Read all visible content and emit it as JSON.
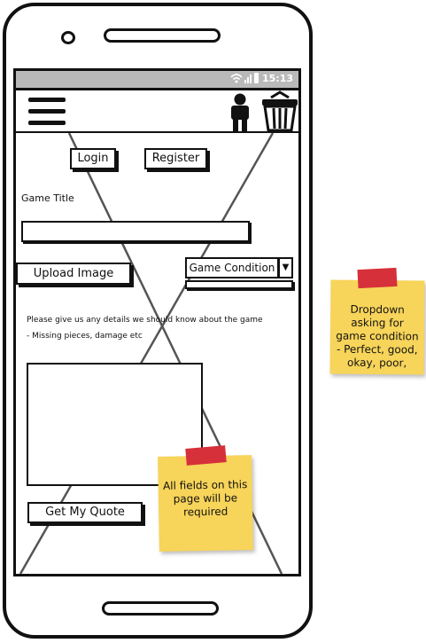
{
  "status_bar": {
    "time": "15:13",
    "icons": [
      "wifi-icon",
      "signal-icon",
      "battery-icon"
    ]
  },
  "header": {
    "menu_icon": "hamburger-icon",
    "profile_icon": "person-icon",
    "cart_icon": "basket-icon"
  },
  "auth": {
    "login_label": "Login",
    "register_label": "Register"
  },
  "form": {
    "game_title_label": "Game Title",
    "game_title_value": "",
    "upload_label": "Upload Image",
    "condition_label": "Game Condition",
    "details_prompt": "Please give us any details we should know about the game",
    "details_hint": "- Missing pieces, damage etc",
    "details_value": "",
    "quote_button": "Get My Quote"
  },
  "notes": {
    "required_note": "All fields on this page will be required",
    "dropdown_note": "Dropdown asking for game condition - Perfect, good, okay, poor,"
  },
  "colors": {
    "sticky": "#f7d45a",
    "tape": "#d6303a",
    "status_bar": "#b9b9b9"
  }
}
